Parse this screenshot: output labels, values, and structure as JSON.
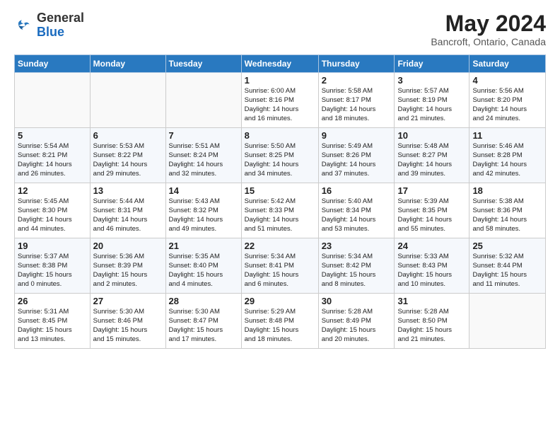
{
  "header": {
    "logo_general": "General",
    "logo_blue": "Blue",
    "month_title": "May 2024",
    "location": "Bancroft, Ontario, Canada"
  },
  "days_of_week": [
    "Sunday",
    "Monday",
    "Tuesday",
    "Wednesday",
    "Thursday",
    "Friday",
    "Saturday"
  ],
  "weeks": [
    [
      {
        "day": "",
        "info": ""
      },
      {
        "day": "",
        "info": ""
      },
      {
        "day": "",
        "info": ""
      },
      {
        "day": "1",
        "info": "Sunrise: 6:00 AM\nSunset: 8:16 PM\nDaylight: 14 hours\nand 16 minutes."
      },
      {
        "day": "2",
        "info": "Sunrise: 5:58 AM\nSunset: 8:17 PM\nDaylight: 14 hours\nand 18 minutes."
      },
      {
        "day": "3",
        "info": "Sunrise: 5:57 AM\nSunset: 8:19 PM\nDaylight: 14 hours\nand 21 minutes."
      },
      {
        "day": "4",
        "info": "Sunrise: 5:56 AM\nSunset: 8:20 PM\nDaylight: 14 hours\nand 24 minutes."
      }
    ],
    [
      {
        "day": "5",
        "info": "Sunrise: 5:54 AM\nSunset: 8:21 PM\nDaylight: 14 hours\nand 26 minutes."
      },
      {
        "day": "6",
        "info": "Sunrise: 5:53 AM\nSunset: 8:22 PM\nDaylight: 14 hours\nand 29 minutes."
      },
      {
        "day": "7",
        "info": "Sunrise: 5:51 AM\nSunset: 8:24 PM\nDaylight: 14 hours\nand 32 minutes."
      },
      {
        "day": "8",
        "info": "Sunrise: 5:50 AM\nSunset: 8:25 PM\nDaylight: 14 hours\nand 34 minutes."
      },
      {
        "day": "9",
        "info": "Sunrise: 5:49 AM\nSunset: 8:26 PM\nDaylight: 14 hours\nand 37 minutes."
      },
      {
        "day": "10",
        "info": "Sunrise: 5:48 AM\nSunset: 8:27 PM\nDaylight: 14 hours\nand 39 minutes."
      },
      {
        "day": "11",
        "info": "Sunrise: 5:46 AM\nSunset: 8:28 PM\nDaylight: 14 hours\nand 42 minutes."
      }
    ],
    [
      {
        "day": "12",
        "info": "Sunrise: 5:45 AM\nSunset: 8:30 PM\nDaylight: 14 hours\nand 44 minutes."
      },
      {
        "day": "13",
        "info": "Sunrise: 5:44 AM\nSunset: 8:31 PM\nDaylight: 14 hours\nand 46 minutes."
      },
      {
        "day": "14",
        "info": "Sunrise: 5:43 AM\nSunset: 8:32 PM\nDaylight: 14 hours\nand 49 minutes."
      },
      {
        "day": "15",
        "info": "Sunrise: 5:42 AM\nSunset: 8:33 PM\nDaylight: 14 hours\nand 51 minutes."
      },
      {
        "day": "16",
        "info": "Sunrise: 5:40 AM\nSunset: 8:34 PM\nDaylight: 14 hours\nand 53 minutes."
      },
      {
        "day": "17",
        "info": "Sunrise: 5:39 AM\nSunset: 8:35 PM\nDaylight: 14 hours\nand 55 minutes."
      },
      {
        "day": "18",
        "info": "Sunrise: 5:38 AM\nSunset: 8:36 PM\nDaylight: 14 hours\nand 58 minutes."
      }
    ],
    [
      {
        "day": "19",
        "info": "Sunrise: 5:37 AM\nSunset: 8:38 PM\nDaylight: 15 hours\nand 0 minutes."
      },
      {
        "day": "20",
        "info": "Sunrise: 5:36 AM\nSunset: 8:39 PM\nDaylight: 15 hours\nand 2 minutes."
      },
      {
        "day": "21",
        "info": "Sunrise: 5:35 AM\nSunset: 8:40 PM\nDaylight: 15 hours\nand 4 minutes."
      },
      {
        "day": "22",
        "info": "Sunrise: 5:34 AM\nSunset: 8:41 PM\nDaylight: 15 hours\nand 6 minutes."
      },
      {
        "day": "23",
        "info": "Sunrise: 5:34 AM\nSunset: 8:42 PM\nDaylight: 15 hours\nand 8 minutes."
      },
      {
        "day": "24",
        "info": "Sunrise: 5:33 AM\nSunset: 8:43 PM\nDaylight: 15 hours\nand 10 minutes."
      },
      {
        "day": "25",
        "info": "Sunrise: 5:32 AM\nSunset: 8:44 PM\nDaylight: 15 hours\nand 11 minutes."
      }
    ],
    [
      {
        "day": "26",
        "info": "Sunrise: 5:31 AM\nSunset: 8:45 PM\nDaylight: 15 hours\nand 13 minutes."
      },
      {
        "day": "27",
        "info": "Sunrise: 5:30 AM\nSunset: 8:46 PM\nDaylight: 15 hours\nand 15 minutes."
      },
      {
        "day": "28",
        "info": "Sunrise: 5:30 AM\nSunset: 8:47 PM\nDaylight: 15 hours\nand 17 minutes."
      },
      {
        "day": "29",
        "info": "Sunrise: 5:29 AM\nSunset: 8:48 PM\nDaylight: 15 hours\nand 18 minutes."
      },
      {
        "day": "30",
        "info": "Sunrise: 5:28 AM\nSunset: 8:49 PM\nDaylight: 15 hours\nand 20 minutes."
      },
      {
        "day": "31",
        "info": "Sunrise: 5:28 AM\nSunset: 8:50 PM\nDaylight: 15 hours\nand 21 minutes."
      },
      {
        "day": "",
        "info": ""
      }
    ]
  ]
}
